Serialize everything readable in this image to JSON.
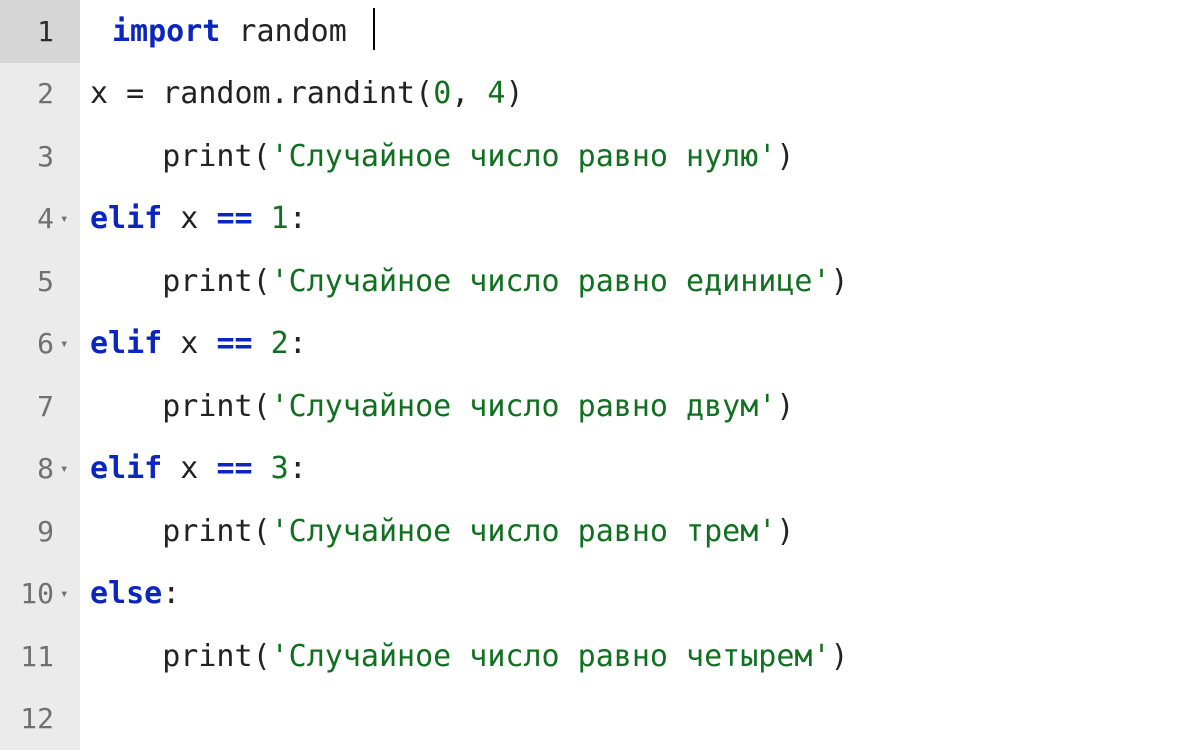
{
  "editor": {
    "active_line": 1,
    "lines": [
      {
        "num": "1",
        "fold": false,
        "active": true,
        "indent": "pad1",
        "cursor_after": true,
        "tokens": [
          {
            "cls": "tok-kw",
            "text": "import"
          },
          {
            "cls": "tok-id",
            "text": " random "
          }
        ]
      },
      {
        "num": "2",
        "fold": false,
        "active": false,
        "indent": "pad0",
        "tokens": [
          {
            "cls": "tok-id",
            "text": "x "
          },
          {
            "cls": "tok-plainop",
            "text": "="
          },
          {
            "cls": "tok-id",
            "text": " random"
          },
          {
            "cls": "tok-pun",
            "text": "."
          },
          {
            "cls": "tok-fn",
            "text": "randint"
          },
          {
            "cls": "tok-pun",
            "text": "("
          },
          {
            "cls": "tok-num",
            "text": "0"
          },
          {
            "cls": "tok-pun",
            "text": ","
          },
          {
            "cls": "tok-id",
            "text": " "
          },
          {
            "cls": "tok-num",
            "text": "4"
          },
          {
            "cls": "tok-pun",
            "text": ")"
          }
        ]
      },
      {
        "num": "3",
        "fold": false,
        "active": false,
        "indent": "pad0",
        "tokens": [
          {
            "cls": "tok-id",
            "text": "    "
          },
          {
            "cls": "tok-fn",
            "text": "print"
          },
          {
            "cls": "tok-pun",
            "text": "("
          },
          {
            "cls": "tok-str",
            "text": "'Случайное число равно нулю'"
          },
          {
            "cls": "tok-pun",
            "text": ")"
          }
        ]
      },
      {
        "num": "4",
        "fold": true,
        "active": false,
        "indent": "pad0",
        "tokens": [
          {
            "cls": "tok-kw",
            "text": "elif"
          },
          {
            "cls": "tok-id",
            "text": " x "
          },
          {
            "cls": "tok-op",
            "text": "=="
          },
          {
            "cls": "tok-id",
            "text": " "
          },
          {
            "cls": "tok-num",
            "text": "1"
          },
          {
            "cls": "tok-pun",
            "text": ":"
          }
        ]
      },
      {
        "num": "5",
        "fold": false,
        "active": false,
        "indent": "pad0",
        "tokens": [
          {
            "cls": "tok-id",
            "text": "    "
          },
          {
            "cls": "tok-fn",
            "text": "print"
          },
          {
            "cls": "tok-pun",
            "text": "("
          },
          {
            "cls": "tok-str",
            "text": "'Случайное число равно единице'"
          },
          {
            "cls": "tok-pun",
            "text": ")"
          }
        ]
      },
      {
        "num": "6",
        "fold": true,
        "active": false,
        "indent": "pad0",
        "tokens": [
          {
            "cls": "tok-kw",
            "text": "elif"
          },
          {
            "cls": "tok-id",
            "text": " x "
          },
          {
            "cls": "tok-op",
            "text": "=="
          },
          {
            "cls": "tok-id",
            "text": " "
          },
          {
            "cls": "tok-num",
            "text": "2"
          },
          {
            "cls": "tok-pun",
            "text": ":"
          }
        ]
      },
      {
        "num": "7",
        "fold": false,
        "active": false,
        "indent": "pad0",
        "tokens": [
          {
            "cls": "tok-id",
            "text": "    "
          },
          {
            "cls": "tok-fn",
            "text": "print"
          },
          {
            "cls": "tok-pun",
            "text": "("
          },
          {
            "cls": "tok-str",
            "text": "'Случайное число равно двум'"
          },
          {
            "cls": "tok-pun",
            "text": ")"
          }
        ]
      },
      {
        "num": "8",
        "fold": true,
        "active": false,
        "indent": "pad0",
        "tokens": [
          {
            "cls": "tok-kw",
            "text": "elif"
          },
          {
            "cls": "tok-id",
            "text": " x "
          },
          {
            "cls": "tok-op",
            "text": "=="
          },
          {
            "cls": "tok-id",
            "text": " "
          },
          {
            "cls": "tok-num",
            "text": "3"
          },
          {
            "cls": "tok-pun",
            "text": ":"
          }
        ]
      },
      {
        "num": "9",
        "fold": false,
        "active": false,
        "indent": "pad0",
        "tokens": [
          {
            "cls": "tok-id",
            "text": "    "
          },
          {
            "cls": "tok-fn",
            "text": "print"
          },
          {
            "cls": "tok-pun",
            "text": "("
          },
          {
            "cls": "tok-str",
            "text": "'Случайное число равно трем'"
          },
          {
            "cls": "tok-pun",
            "text": ")"
          }
        ]
      },
      {
        "num": "10",
        "fold": true,
        "active": false,
        "indent": "pad0",
        "tokens": [
          {
            "cls": "tok-kw",
            "text": "else"
          },
          {
            "cls": "tok-pun",
            "text": ":"
          }
        ]
      },
      {
        "num": "11",
        "fold": false,
        "active": false,
        "indent": "pad0",
        "tokens": [
          {
            "cls": "tok-id",
            "text": "    "
          },
          {
            "cls": "tok-fn",
            "text": "print"
          },
          {
            "cls": "tok-pun",
            "text": "("
          },
          {
            "cls": "tok-str",
            "text": "'Случайное число равно четырем'"
          },
          {
            "cls": "tok-pun",
            "text": ")"
          }
        ]
      },
      {
        "num": "12",
        "fold": false,
        "active": false,
        "indent": "pad0",
        "tokens": []
      }
    ]
  }
}
